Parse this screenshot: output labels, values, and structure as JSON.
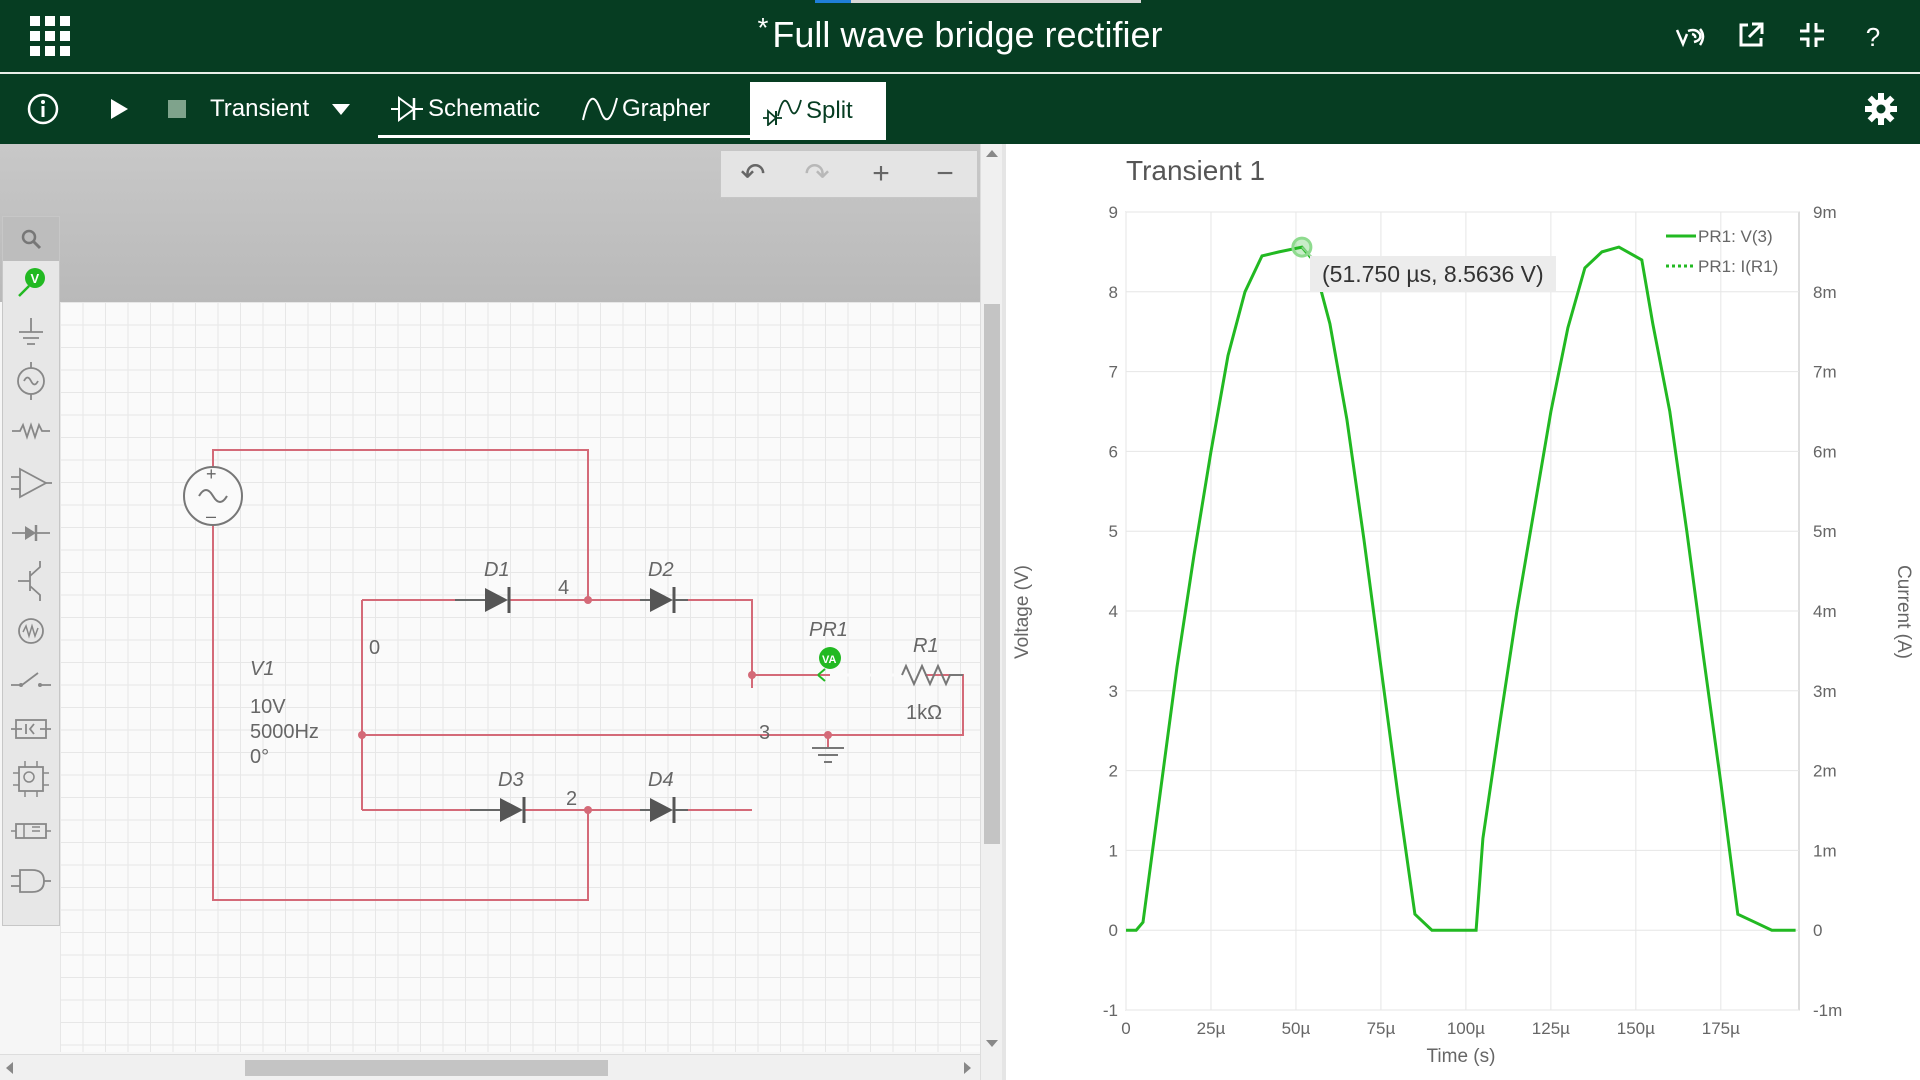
{
  "header": {
    "title": "Full wave bridge rectifier",
    "modified_mark": "*",
    "icons": [
      "apps-grid-icon",
      "probe-voltage-icon",
      "open-external-icon",
      "collapse-icon",
      "help-icon"
    ],
    "help_label": "?"
  },
  "toolbar": {
    "analysis_type": "Transient",
    "tabs": [
      {
        "label": "Schematic",
        "icon": "diode-icon"
      },
      {
        "label": "Grapher",
        "icon": "sine-wave-icon"
      },
      {
        "label": "Split",
        "icon": "split-icon"
      }
    ],
    "active_tab": "Split",
    "icons": [
      "info-icon",
      "play-icon",
      "stop-icon",
      "dropdown-arrow-icon",
      "settings-gear-icon"
    ]
  },
  "schematic": {
    "source": {
      "name": "V1",
      "amplitude": "10V",
      "frequency": "5000Hz",
      "phase": "0°"
    },
    "diodes": [
      "D1",
      "D2",
      "D3",
      "D4"
    ],
    "nodes": [
      "0",
      "4",
      "3",
      "2"
    ],
    "probe": {
      "name": "PR1",
      "badge": "VA"
    },
    "resistor": {
      "name": "R1",
      "value": "1kΩ"
    },
    "palette_icons": [
      "search-icon",
      "voltage-probe-icon",
      "ground-icon",
      "ac-source-icon",
      "resistor-icon",
      "opamp-icon",
      "diode-icon",
      "transistor-icon",
      "lamp-icon",
      "switch-icon",
      "relay-icon",
      "ic-icon",
      "module-icon",
      "logic-gate-icon"
    ],
    "palette_probe_badge": "V"
  },
  "grapher": {
    "title": "Transient 1",
    "tooltip": "(51.750 µs, 8.5636 V)",
    "legend": [
      "PR1: V(3)",
      "PR1: I(R1)"
    ]
  },
  "chart_data": {
    "type": "line",
    "title": "Transient 1",
    "xlabel": "Time (s)",
    "ylabel": "Voltage (V)",
    "y2label": "Current (A)",
    "xlim": [
      0,
      198
    ],
    "ylim": [
      -1,
      9
    ],
    "y2lim": [
      -0.001,
      0.009
    ],
    "x_ticks": [
      "0",
      "25µ",
      "50µ",
      "75µ",
      "100µ",
      "125µ",
      "150µ",
      "175µ"
    ],
    "y_ticks": [
      "-1",
      "0",
      "1",
      "2",
      "3",
      "4",
      "5",
      "6",
      "7",
      "8",
      "9"
    ],
    "y2_ticks": [
      "-1m",
      "0",
      "1m",
      "2m",
      "3m",
      "4m",
      "5m",
      "6m",
      "7m",
      "8m",
      "9m"
    ],
    "grid": true,
    "legend_position": "top-right",
    "series": [
      {
        "name": "PR1: V(3)",
        "color": "#22b922",
        "style": "solid",
        "x": [
          0,
          3,
          5,
          10,
          15,
          20,
          25,
          30,
          35,
          40,
          45,
          51.75,
          55,
          60,
          65,
          70,
          75,
          80,
          85,
          90,
          95,
          100,
          103,
          105,
          110,
          115,
          120,
          125,
          130,
          135,
          140,
          145,
          151.75,
          155,
          160,
          165,
          170,
          175,
          180,
          185,
          190,
          195,
          197
        ],
        "y": [
          0,
          0,
          0.1,
          1.7,
          3.3,
          4.7,
          6.0,
          7.2,
          8.0,
          8.45,
          8.5,
          8.56,
          8.4,
          7.6,
          6.4,
          4.9,
          3.3,
          1.7,
          0.2,
          0.0,
          0.0,
          0.0,
          0.0,
          1.15,
          2.6,
          4.0,
          5.25,
          6.5,
          7.55,
          8.3,
          8.5,
          8.56,
          8.4,
          7.6,
          6.5,
          5.0,
          3.4,
          1.85,
          0.2,
          0.1,
          0.0,
          0.0,
          0.0
        ]
      },
      {
        "name": "PR1: I(R1)",
        "color": "#22b922",
        "style": "dotted",
        "x": [],
        "y": []
      }
    ]
  }
}
